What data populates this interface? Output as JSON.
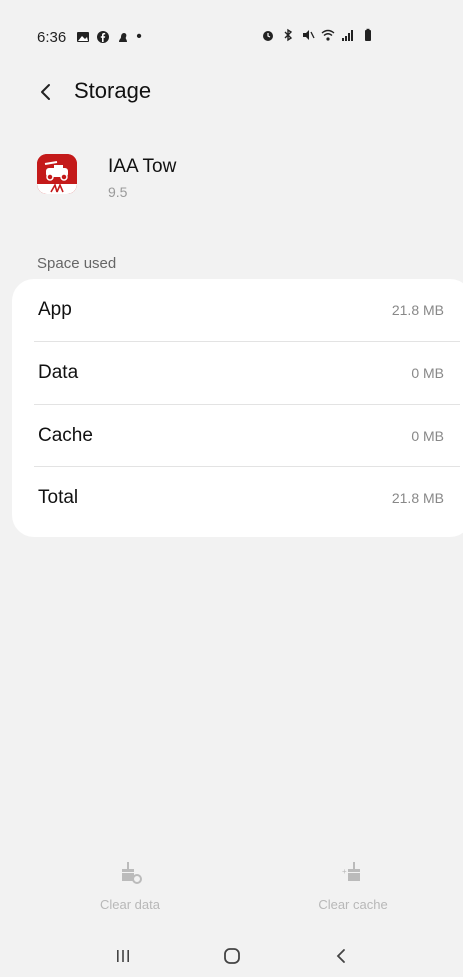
{
  "status_bar": {
    "time": "6:36",
    "left_icons": [
      "gallery-icon",
      "facebook-icon",
      "notification-icon",
      "dot-icon"
    ],
    "right_icons": [
      "alarm-icon",
      "bluetooth-icon",
      "mute-icon",
      "wifi-icon",
      "signal-icon",
      "battery-icon"
    ]
  },
  "header": {
    "title": "Storage"
  },
  "app": {
    "name": "IAA Tow",
    "version": "9.5",
    "icon_color": "#c41a1a"
  },
  "section": {
    "label": "Space used"
  },
  "storage_rows": [
    {
      "label": "App",
      "value": "21.8 MB"
    },
    {
      "label": "Data",
      "value": "0 MB"
    },
    {
      "label": "Cache",
      "value": "0 MB"
    },
    {
      "label": "Total",
      "value": "21.8 MB"
    }
  ],
  "actions": {
    "clear_data": "Clear data",
    "clear_cache": "Clear cache"
  },
  "nav": {
    "buttons": [
      "recents-icon",
      "home-icon",
      "back-icon"
    ]
  }
}
